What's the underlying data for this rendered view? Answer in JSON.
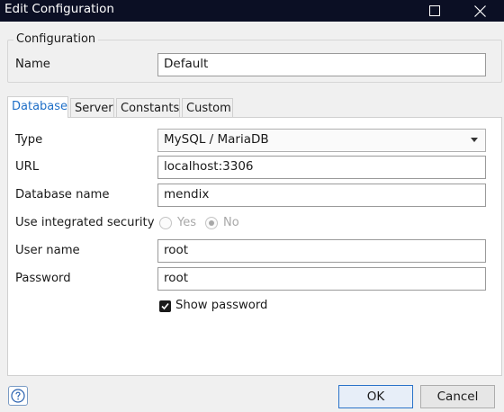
{
  "window": {
    "title": "Edit Configuration",
    "maximize_icon": "maximize-icon",
    "close_icon": "close-icon"
  },
  "configuration": {
    "legend": "Configuration",
    "name_label": "Name",
    "name_value": "Default"
  },
  "tabs": [
    {
      "label": "Database",
      "active": true
    },
    {
      "label": "Server",
      "active": false
    },
    {
      "label": "Constants",
      "active": false
    },
    {
      "label": "Custom",
      "active": false
    }
  ],
  "database": {
    "type_label": "Type",
    "type_value": "MySQL / MariaDB",
    "url_label": "URL",
    "url_value": "localhost:3306",
    "dbname_label": "Database name",
    "dbname_value": "mendix",
    "integrated_label": "Use integrated security",
    "integrated_yes": "Yes",
    "integrated_no": "No",
    "integrated_selected": "No",
    "user_label": "User name",
    "user_value": "root",
    "password_label": "Password",
    "password_value": "root",
    "show_password_label": "Show password",
    "show_password_checked": true
  },
  "footer": {
    "help_icon": "help-icon",
    "ok_label": "OK",
    "cancel_label": "Cancel"
  },
  "colors": {
    "titlebar": "#0b0f24",
    "active_tab_text": "#1f6fc7",
    "primary_border": "#2a73c9"
  }
}
